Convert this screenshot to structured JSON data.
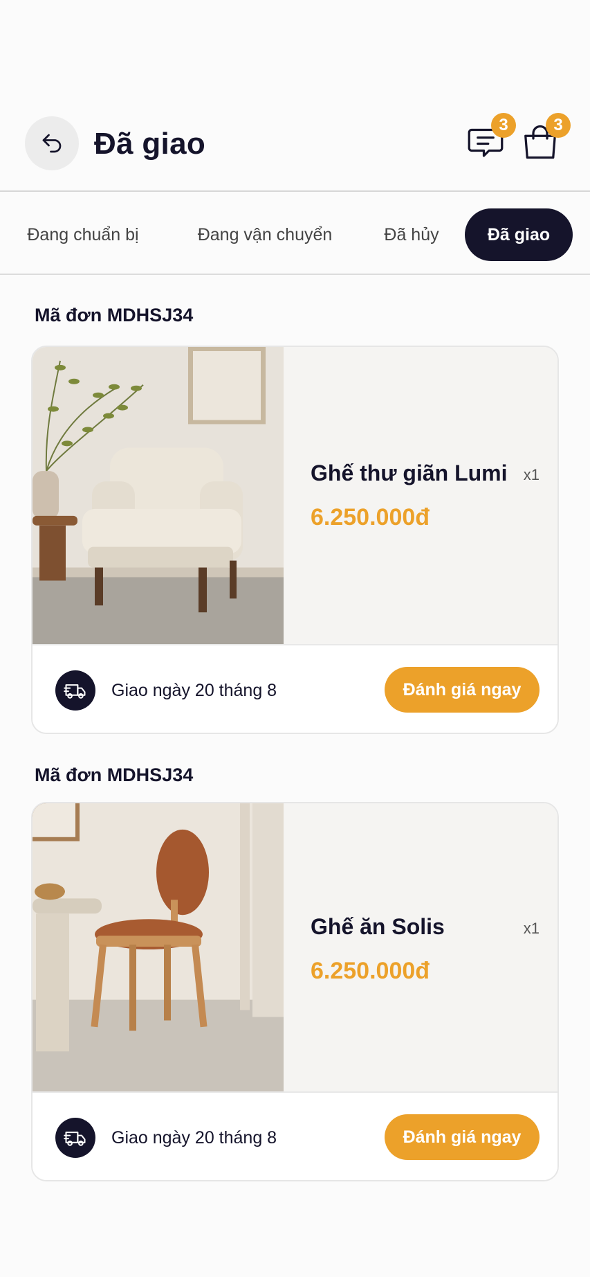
{
  "header": {
    "title": "Đã giao",
    "messages_badge": "3",
    "cart_badge": "3"
  },
  "tabs": [
    {
      "label": "Đang chuẩn bị",
      "active": false
    },
    {
      "label": "Đang vận chuyển",
      "active": false
    },
    {
      "label": "Đã hủy",
      "active": false
    },
    {
      "label": "Đã giao",
      "active": true
    }
  ],
  "orders": [
    {
      "order_id": "Mã đơn MDHSJ34",
      "product_name": "Ghế thư giãn Lumi",
      "quantity": "x1",
      "price": "6.250.000đ",
      "image": "armchair-photo",
      "shipping_text": "Giao ngày 20 tháng 8",
      "button_label": "Đánh giá ngay"
    },
    {
      "order_id": "Mã đơn MDHSJ34",
      "product_name": "Ghế ăn Solis",
      "quantity": "x1",
      "price": "6.250.000đ",
      "image": "dining-chair-photo",
      "shipping_text": "Giao ngày 20 tháng 8",
      "button_label": "Đánh giá ngay"
    }
  ],
  "colors": {
    "accent": "#eca12a",
    "dark": "#15142b",
    "background": "#fbfbfb"
  }
}
